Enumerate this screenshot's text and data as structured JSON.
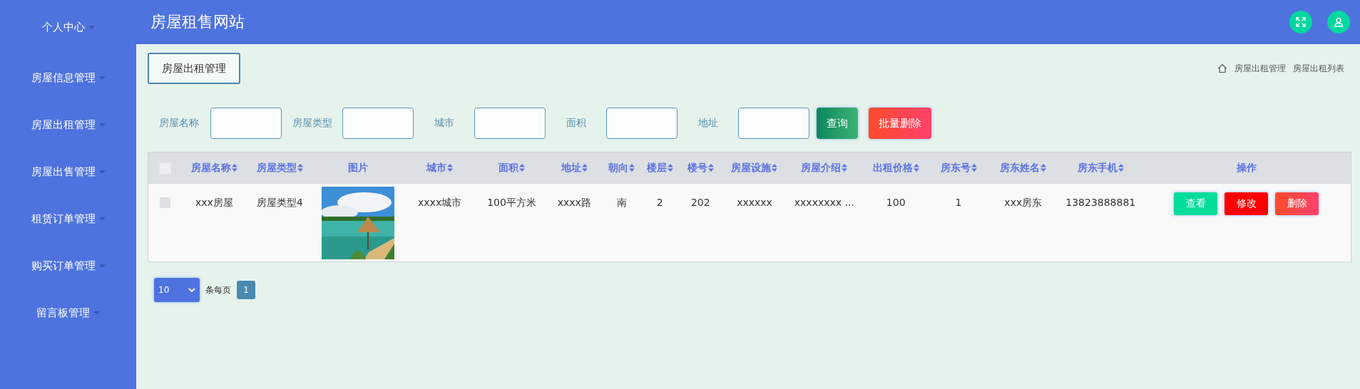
{
  "sidebar": {
    "items": [
      {
        "label": "个人中心",
        "has_arrow": true
      },
      {
        "label": "房屋信息管理",
        "has_arrow": true
      },
      {
        "label": "房屋出租管理",
        "has_arrow": true
      },
      {
        "label": "房屋出售管理",
        "has_arrow": true
      },
      {
        "label": "租赁订单管理",
        "has_arrow": true
      },
      {
        "label": "购买订单管理",
        "has_arrow": true
      },
      {
        "label": "留言板管理",
        "has_arrow": true
      }
    ]
  },
  "header": {
    "title": "房屋租售网站"
  },
  "tab": {
    "label": "房屋出租管理"
  },
  "breadcrumb": [
    "房屋出租管理",
    "房屋出租列表"
  ],
  "search": {
    "fields": [
      {
        "label": "房屋名称"
      },
      {
        "label": "房屋类型"
      },
      {
        "label": "城市"
      },
      {
        "label": "面积"
      },
      {
        "label": "地址"
      }
    ],
    "buttons": [
      {
        "kind": "query",
        "label": "查询"
      },
      {
        "kind": "batch_delete",
        "label": "批量删除"
      }
    ]
  },
  "table": {
    "select_all": {
      "checked": false
    },
    "columns": [
      {
        "label": "房屋名称",
        "sortable": true
      },
      {
        "label": "房屋类型",
        "sortable": true
      },
      {
        "label": "图片",
        "sortable": false
      },
      {
        "label": "城市",
        "sortable": true
      },
      {
        "label": "面积",
        "sortable": true
      },
      {
        "label": "地址",
        "sortable": true
      },
      {
        "label": "朝向",
        "sortable": true
      },
      {
        "label": "楼层",
        "sortable": true
      },
      {
        "label": "楼号",
        "sortable": true
      },
      {
        "label": "房屋设施",
        "sortable": true
      },
      {
        "label": "房屋介绍",
        "sortable": true
      },
      {
        "label": "出租价格",
        "sortable": true
      },
      {
        "label": "房东号",
        "sortable": true
      },
      {
        "label": "房东姓名",
        "sortable": true
      },
      {
        "label": "房东手机",
        "sortable": true
      },
      {
        "label": "操作",
        "sortable": false
      }
    ],
    "rows": [
      {
        "checked": false,
        "cells": [
          {
            "kind": "text",
            "text": "xxx房屋"
          },
          {
            "kind": "text",
            "text": "房屋类型4"
          },
          {
            "kind": "picture"
          },
          {
            "kind": "text",
            "text": "xxxx城市"
          },
          {
            "kind": "text",
            "text": "100平方米"
          },
          {
            "kind": "text",
            "text": "xxxx路"
          },
          {
            "kind": "text",
            "text": "南"
          },
          {
            "kind": "text",
            "text": "2"
          },
          {
            "kind": "text",
            "text": "202"
          },
          {
            "kind": "text",
            "text": "xxxxxx"
          },
          {
            "kind": "text",
            "text": "xxxxxxxx ..."
          },
          {
            "kind": "text",
            "text": "100"
          },
          {
            "kind": "text",
            "text": "1"
          },
          {
            "kind": "text",
            "text": "xxx房东"
          },
          {
            "kind": "text",
            "text": "13823888881"
          }
        ],
        "actions": [
          {
            "kind": "view",
            "label": "查看"
          },
          {
            "kind": "edit",
            "label": "修改"
          },
          {
            "kind": "delete",
            "label": "删除"
          }
        ]
      }
    ]
  },
  "pagination": {
    "page_size": "10",
    "per_page_label": "条每页",
    "pages": [
      {
        "label": "1",
        "selected": true
      }
    ]
  }
}
